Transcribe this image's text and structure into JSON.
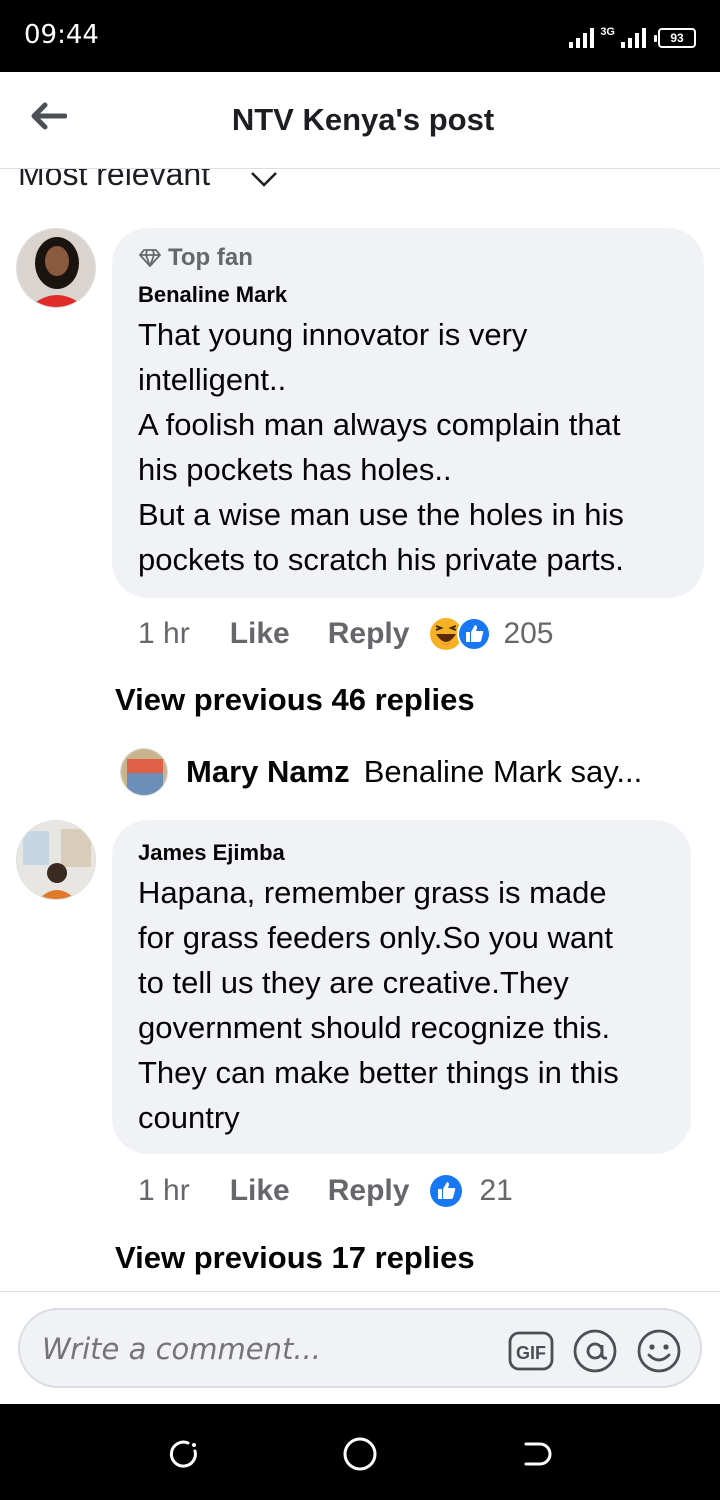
{
  "status_bar": {
    "time": "09:44",
    "network": "3G",
    "battery": "93"
  },
  "header": {
    "title": "NTV Kenya's post",
    "back_icon": "arrow-left-icon"
  },
  "sort": {
    "label": "Most relevant"
  },
  "comments": [
    {
      "badge": "Top fan",
      "author": "Benaline Mark",
      "lines": [
        "That young innovator is very",
        "intelligent..",
        "A foolish man always complain that",
        "his pockets has holes..",
        "But a wise man use the holes in his",
        "pockets to scratch his private parts."
      ],
      "time": "1 hr",
      "like_label": "Like",
      "reply_label": "Reply",
      "reaction_count": "205",
      "view_replies": "View previous 46 replies",
      "latest_reply": {
        "name": "Mary Namz",
        "snippet": "Benaline Mark say..."
      }
    },
    {
      "author": "James Ejimba",
      "lines": [
        "Hapana, remember grass is made",
        "for grass feeders only.So you want",
        "to tell us they are creative.They",
        "government should recognize this.",
        "They can make better things in this",
        "country"
      ],
      "time": "1 hr",
      "like_label": "Like",
      "reply_label": "Reply",
      "reaction_count": "21",
      "view_replies": "View previous 17 replies"
    }
  ],
  "composer": {
    "placeholder": "Write a comment...",
    "gif_label": "GIF"
  },
  "colors": {
    "like_blue": "#1877f2",
    "haha_yellow": "#f7b125",
    "bubble_bg": "#f0f2f5",
    "meta_gray": "#65676b"
  }
}
